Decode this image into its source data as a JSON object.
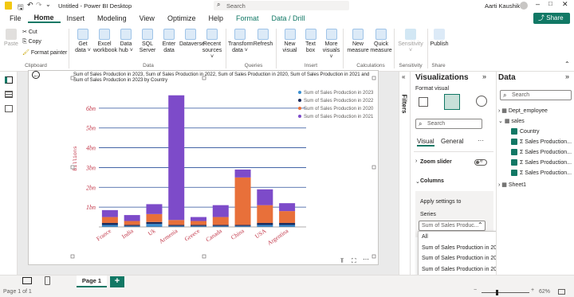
{
  "titlebar": {
    "doc_title": "Untitled - Power BI Desktop",
    "search_placeholder": "Search",
    "user_name": "Aarti Kaushik",
    "share_label": "Share"
  },
  "menu": [
    "File",
    "Home",
    "Insert",
    "Modeling",
    "View",
    "Optimize",
    "Help",
    "Format",
    "Data / Drill"
  ],
  "ribbon": {
    "clipboard": {
      "paste": "Paste",
      "cut": "Cut",
      "copy": "Copy",
      "format_painter": "Format painter",
      "label": "Clipboard"
    },
    "data_buttons": [
      {
        "l1": "Get",
        "l2": "data ˅"
      },
      {
        "l1": "Excel",
        "l2": "workbook"
      },
      {
        "l1": "Data",
        "l2": "hub ˅"
      },
      {
        "l1": "SQL",
        "l2": "Server"
      },
      {
        "l1": "Enter",
        "l2": "data"
      },
      {
        "l1": "Dataverse",
        "l2": ""
      },
      {
        "l1": "Recent",
        "l2": "sources ˅"
      }
    ],
    "data_label": "Data",
    "queries_buttons": [
      {
        "l1": "Transform",
        "l2": "data ˅"
      },
      {
        "l1": "Refresh",
        "l2": ""
      }
    ],
    "queries_label": "Queries",
    "insert_buttons": [
      {
        "l1": "New",
        "l2": "visual"
      },
      {
        "l1": "Text",
        "l2": "box"
      },
      {
        "l1": "More",
        "l2": "visuals ˅"
      }
    ],
    "insert_label": "Insert",
    "calc_buttons": [
      {
        "l1": "New",
        "l2": "measure"
      },
      {
        "l1": "Quick",
        "l2": "measure"
      }
    ],
    "calc_label": "Calculations",
    "sensitivity": {
      "l1": "Sensitivity",
      "l2": "˅",
      "label": "Sensitivity"
    },
    "publish": {
      "l1": "Publish",
      "label": "Share"
    }
  },
  "chart_data": {
    "type": "bar",
    "stacked": true,
    "title": "Sum of Sales Production in 2023, Sum of Sales Production in 2022, Sum of Sales Production in 2020, Sum of Sales Production in 2021 and Sum of Sales Production in 2023 by Country",
    "ylabel": "Billions",
    "ylim": [
      0,
      7
    ],
    "yticks": [
      "1bn",
      "2bn",
      "3bn",
      "4bn",
      "5bn",
      "6bn"
    ],
    "categories": [
      "France",
      "India",
      "Uk",
      "Armenia",
      "Greece",
      "Canada",
      "China",
      "USA",
      "Argentina"
    ],
    "series": [
      {
        "name": "Sum of Sales Production in 2023",
        "color": "#3a8fd1",
        "values": [
          0.1,
          0.05,
          0.15,
          0.05,
          0.05,
          0.05,
          0.05,
          0.1,
          0.1
        ]
      },
      {
        "name": "Sum of Sales Production in 2022",
        "color": "#1b2a5c",
        "values": [
          0.1,
          0.05,
          0.1,
          0.05,
          0.05,
          0.05,
          0.05,
          0.1,
          0.1
        ]
      },
      {
        "name": "Sum of Sales Production in 2020",
        "color": "#e8703a",
        "values": [
          0.3,
          0.2,
          0.4,
          0.25,
          0.2,
          0.4,
          2.4,
          0.9,
          0.6
        ]
      },
      {
        "name": "Sum of Sales Production in 2021",
        "color": "#7d4bc9",
        "values": [
          0.35,
          0.3,
          0.5,
          6.3,
          0.2,
          0.6,
          0.4,
          0.8,
          0.4
        ]
      }
    ],
    "grid": true,
    "legend_position": "top-right"
  },
  "viz_pane": {
    "title": "Visualizations",
    "format_visual": "Format visual",
    "search_placeholder": "Search",
    "tab_visual": "Visual",
    "tab_general": "General",
    "more": "···",
    "zoom_slider": "Zoom slider",
    "toggle_state": "Off",
    "columns": "Columns",
    "apply_settings": "Apply settings to",
    "series_label": "Series",
    "series_value": "Sum of Sales Produc...",
    "dropdown_options": [
      "All",
      "Sum of Sales Production in 2023",
      "Sum of Sales Production in 2022",
      "Sum of Sales Production in 2020",
      "Sum of Sales Production in 2021"
    ],
    "selected_option": "Sum of Sales Production in 2021"
  },
  "filters_label": "Filters",
  "data_pane": {
    "title": "Data",
    "search_placeholder": "Search",
    "tables": [
      {
        "name": "Dept_employee",
        "expanded": false
      },
      {
        "name": "sales",
        "expanded": true
      },
      {
        "name": "Sheet1",
        "expanded": false
      }
    ],
    "fields": [
      "Country",
      "Sales Production...",
      "Sales Production...",
      "Sales Production...",
      "Sales Production..."
    ]
  },
  "pages": {
    "page1": "Page 1",
    "add": "+"
  },
  "status": {
    "page": "Page 1 of 1",
    "zoom": "62%"
  }
}
